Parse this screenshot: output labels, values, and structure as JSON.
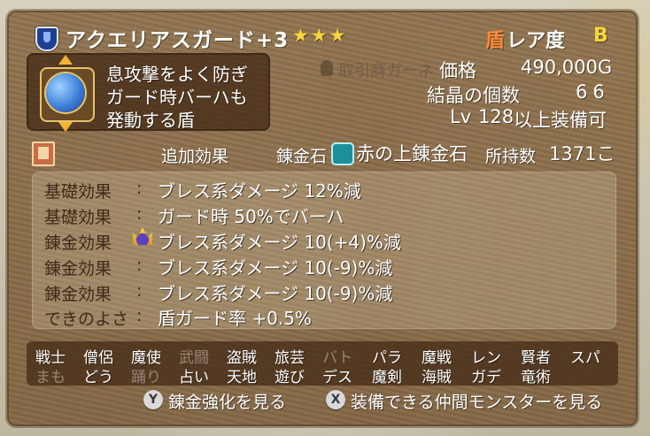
{
  "item": {
    "name": "アクエリアスガード+3",
    "stars": "★★★",
    "category": "盾",
    "rarity_label": "レア度",
    "rarity_value": "B",
    "description": [
      "息攻撃をよく防ぎ",
      "ガード時バーハも",
      "発動する盾"
    ]
  },
  "market": {
    "trade_label": "取引商ガーネ",
    "price_label": "価格",
    "price_value": "490,000G",
    "crystal_label": "結晶の個数",
    "crystal_value": "66",
    "lv_prefix": "Lv",
    "lv_value": "128",
    "lv_suffix": "以上装備可"
  },
  "alchemy": {
    "additional_effects_label": "追加効果",
    "stone_label": "錬金石",
    "stone_name": "赤の上錬金石",
    "owned_label": "所持数",
    "owned_value": "1371こ"
  },
  "effects": [
    {
      "label": "基礎効果",
      "colon": ":",
      "value": "ブレス系ダメージ 12%減"
    },
    {
      "label": "基礎効果",
      "colon": ":",
      "value": "ガード時 50%でバーハ"
    },
    {
      "label": "錬金効果",
      "colon": "",
      "value": "ブレス系ダメージ 10(+4)%減"
    },
    {
      "label": "錬金効果",
      "colon": ":",
      "value": "ブレス系ダメージ 10(-9)%減"
    },
    {
      "label": "錬金効果",
      "colon": ":",
      "value": "ブレス系ダメージ 10(-9)%減"
    },
    {
      "label": "できのよさ",
      "colon": ":",
      "value": "盾ガード率 +0.5%"
    }
  ],
  "jobs": {
    "row1": [
      "戦士",
      "僧侶",
      "魔使",
      "武闘",
      "盗賊",
      "旅芸",
      "バト",
      "パラ",
      "魔戦",
      "レン",
      "賢者",
      "スパ"
    ],
    "row2": [
      "まも",
      "どう",
      "踊り",
      "占い",
      "天地",
      "遊び",
      "デス",
      "魔剣",
      "海賊",
      "ガデ",
      "竜術"
    ],
    "dim_row1": [
      3,
      6
    ],
    "dim_row2": [
      0,
      2
    ]
  },
  "buttons": [
    {
      "key": "Y",
      "label": "錬金強化を見る"
    },
    {
      "key": "X",
      "label": "装備できる仲間モンスターを見る"
    }
  ],
  "icons": {
    "category_badge": "shield-badge-icon",
    "item_icon": "aquarius-shield-icon",
    "alchemy_book": "alchemy-book-icon",
    "stone": "alchemy-stone-icon",
    "crown": "crown-icon",
    "trade": "merchant-icon"
  },
  "colors": {
    "star": "#f6d63a",
    "category": "#ff8a3a",
    "rarity": "#f6d63a",
    "panel": "#8a6b46"
  }
}
